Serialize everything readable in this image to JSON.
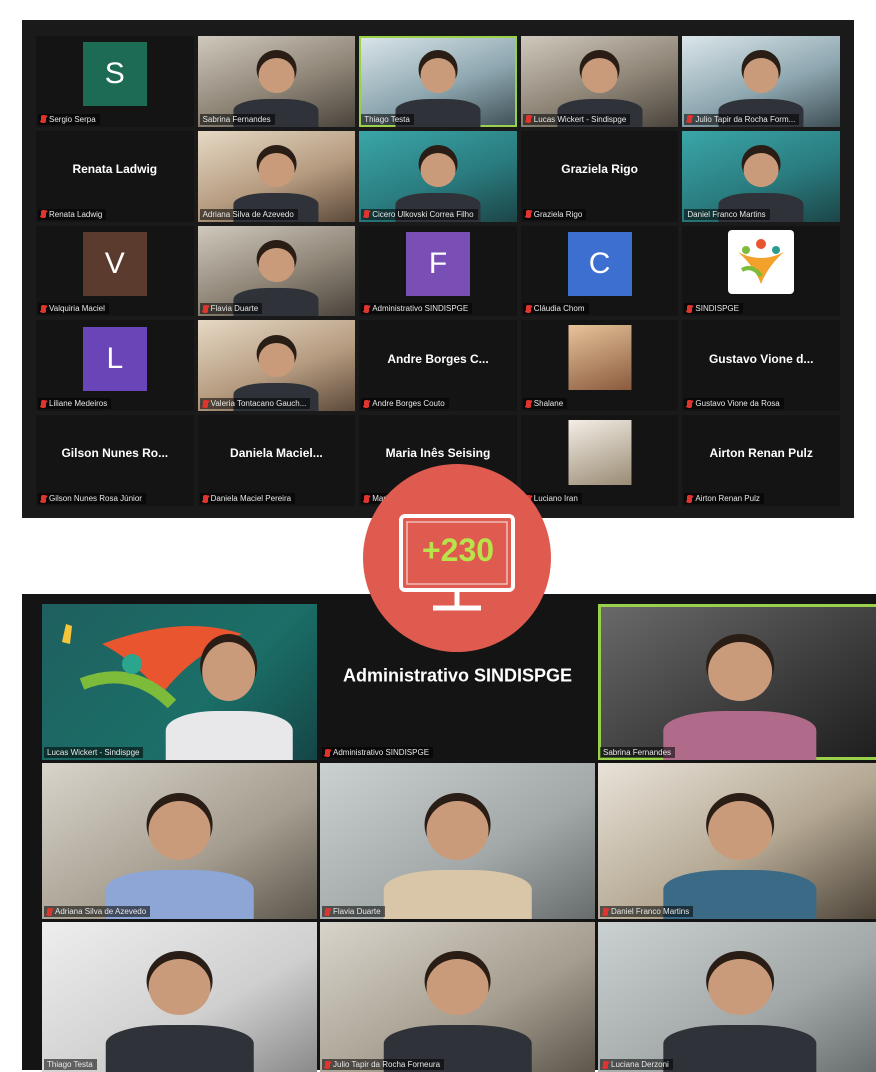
{
  "top_gallery": {
    "tiles": [
      {
        "name": "Sergio Serpa",
        "initial": "S",
        "avatar_color": "#1e6b55"
      },
      {
        "name": "Sabrina Fernandes"
      },
      {
        "name": "Thiago Testa"
      },
      {
        "name": "Lucas Wickert - Sindispge"
      },
      {
        "name": "Julio Tapir da Rocha Form..."
      },
      {
        "name": "Renata Ladwig",
        "display": "Renata Ladwig"
      },
      {
        "name": "Adriana Silva de Azevedo"
      },
      {
        "name": "Cicero Ulkovski Correa Filho"
      },
      {
        "name": "Graziela Rigo",
        "display": "Graziela Rigo"
      },
      {
        "name": "Daniel Franco Martins"
      },
      {
        "name": "Valquiria Maciel",
        "initial": "V",
        "avatar_color": "#5a3b2d"
      },
      {
        "name": "Flavia Duarte"
      },
      {
        "name": "Administrativo SINDISPGE",
        "initial": "F",
        "avatar_color": "#7a4fb5"
      },
      {
        "name": "Cláudia Chom",
        "initial": "C",
        "avatar_color": "#3d6fd1"
      },
      {
        "name": "SINDISPGE"
      },
      {
        "name": "Liliane Medeiros",
        "initial": "L",
        "avatar_color": "#6a45b8"
      },
      {
        "name": "Valeria Tontacano Gauch..."
      },
      {
        "name": "Andre Borges Couto",
        "display": "Andre Borges C..."
      },
      {
        "name": "Shalane"
      },
      {
        "name": "Gustavo Vione da Rosa",
        "display": "Gustavo Vione d..."
      },
      {
        "name": "Gilson Nunes Rosa Júnior",
        "display": "Gilson Nunes Ro..."
      },
      {
        "name": "Daniela Maciel Pereira",
        "display": "Daniela Maciel..."
      },
      {
        "name": "Maria Ines Seising",
        "display": "Maria Inês Seising"
      },
      {
        "name": "Luciano Iran"
      },
      {
        "name": "Airton Renan Pulz",
        "display": "Airton Renan Pulz"
      }
    ]
  },
  "participant_badge": {
    "count": "+230"
  },
  "bottom_gallery": {
    "tiles": [
      {
        "name": "Lucas Wickert - Sindispge"
      },
      {
        "name": "Administrativo SINDISPGE",
        "display": "Administrativo SINDISPGE"
      },
      {
        "name": "Sabrina Fernandes"
      },
      {
        "name": "Adriana Silva de Azevedo"
      },
      {
        "name": "Flavia Duarte"
      },
      {
        "name": "Daniel Franco Martins"
      },
      {
        "name": "Thiago Testa"
      },
      {
        "name": "Julio Tapir da Rocha Forneura"
      },
      {
        "name": "Luciana Derzoni"
      }
    ]
  },
  "colors": {
    "accent_green": "#9ad14b",
    "badge_red": "#df5a4f",
    "mic_red": "#e0342e"
  }
}
